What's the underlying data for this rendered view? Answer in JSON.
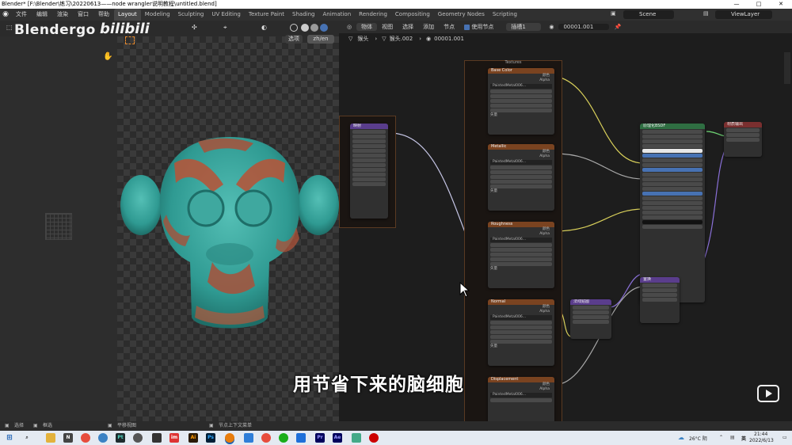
{
  "window": {
    "title": "Blender* [F:\\Blender\\练习\\20220613——node wrangler说明教程\\untitled.blend]",
    "controls": [
      "—",
      "□",
      "✕"
    ]
  },
  "menu": [
    "文件",
    "编辑",
    "渲染",
    "窗口",
    "帮助"
  ],
  "workspaces": [
    "Layout",
    "Modeling",
    "Sculpting",
    "UV Editing",
    "Texture Paint",
    "Shading",
    "Animation",
    "Rendering",
    "Compositing",
    "Geometry Nodes",
    "Scripting"
  ],
  "active_workspace": "Layout",
  "scene": "Scene",
  "view_layer": "ViewLayer",
  "watermark": {
    "text": "Blendergo",
    "bili": "bilibili"
  },
  "viewport": {
    "options_label": "选项",
    "lang_label": "zh/en"
  },
  "node_editor": {
    "header_items": [
      "物体",
      "视图",
      "选择",
      "添加",
      "节点"
    ],
    "use_nodes_label": "使用节点",
    "slot": "插槽1",
    "material": "00001.001",
    "breadcrumb": [
      "猴头",
      "猴头.002",
      "00001.001"
    ],
    "frame_label": "Textures",
    "tex_nodes": [
      {
        "title": "Base Color",
        "image": "PaintedMetal006..."
      },
      {
        "title": "Metallic",
        "image": "PaintedMetal006..."
      },
      {
        "title": "Roughness",
        "image": "PaintedMetal006..."
      },
      {
        "title": "Normal",
        "image": "PaintedMetal006..."
      },
      {
        "title": "Displacement",
        "image": "PaintedMetal006..."
      }
    ],
    "tex_rows": [
      "颜色",
      "Alpha",
      "线性",
      "平面",
      "重复",
      "单张图像",
      "色彩空间",
      "矢量"
    ],
    "mapping_title": "映射",
    "bsdf_title": "原理化BSDF",
    "output_title": "材质输出",
    "normal_map_title": "法线贴图",
    "displacement_title": "置换"
  },
  "subtitle": "用节省下来的脑细胞",
  "statusbar": {
    "select": "选择",
    "box": "框选",
    "pan": "平移视图",
    "context": "节点上下文菜单"
  },
  "taskbar": {
    "weather": "26°C 阴",
    "time": "21:44",
    "date": "2022/6/13",
    "ime": "英"
  }
}
